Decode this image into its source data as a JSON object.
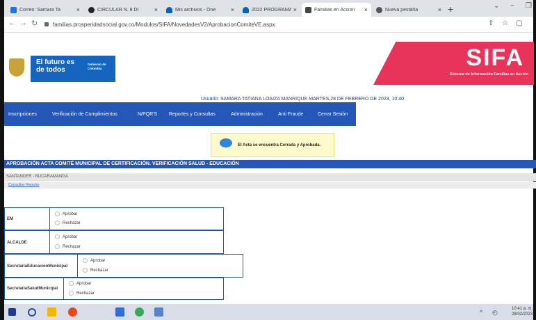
{
  "browser": {
    "tabs": [
      {
        "label": "Correo: Samara Ta",
        "active": false,
        "icon_color": "#1a73e8"
      },
      {
        "label": "CIRCULAR N. 8 DI",
        "active": false,
        "icon_color": "#222222"
      },
      {
        "label": "Mis archivos - One",
        "active": false,
        "icon_color": "#0364b8"
      },
      {
        "label": "2022 PROGRAMA",
        "active": false,
        "icon_color": "#0364b8"
      },
      {
        "label": "Familias en Acción",
        "active": true,
        "icon_color": "#444444"
      },
      {
        "label": "Nueva pestaña",
        "active": false,
        "icon_color": "#555555"
      }
    ],
    "close_glyph": "×",
    "newtab_glyph": "+",
    "minimize_glyph": "−",
    "url": "familias.prosperidadsocial.gov.co/Modulos/SIFA/NovedadesV2/AprobacionComiteVE.aspx"
  },
  "header": {
    "logo_main": "El futuro es de todos",
    "logo_sub": "Gobierno de Colombia",
    "sifa_title": "SIFA",
    "sifa_subtitle": "Sistema de Información Familias en Acción",
    "user_line": "Usuario: SAMARA TATIANA LOAIZA MANRIQUE MARTES,28 DE FEBRERO DE 2023, 10:40"
  },
  "nav": {
    "items": [
      "Inscripciones",
      "Verificación de Cumplimientos",
      "N/PQR'S",
      "Reportes y Consultas",
      "Administración",
      "Anti Fraude",
      "Cerrar Sesión"
    ]
  },
  "notice": {
    "text": "El Acta se encuentra Cerrada y Aprobada."
  },
  "section": {
    "title": "APROBACIÓN ACTA COMITÉ MUNICIPAL DE CERTIFICACIÓN. VERIFICACIÓN SALUD - EDUCACIÓN",
    "location": "SANTANDER - BUCARAMANGA",
    "consultar": "Consultar Reporte"
  },
  "approvals": [
    {
      "label": "EM",
      "approve": "Aprobar",
      "reject": "Rechazar"
    },
    {
      "label": "ALCALDE",
      "approve": "Aprobar",
      "reject": "Rechazar"
    },
    {
      "label": "SecretariaEducacionMunicipal",
      "approve": "Aprobar",
      "reject": "Rechazar"
    },
    {
      "label": "SecretariaSaludMunicipal",
      "approve": "Aprobar",
      "reject": "Rechazar"
    }
  ],
  "taskbar": {
    "time": "10:41 a. m.",
    "date": "28/02/2023",
    "tray_up": "^"
  },
  "colors": {
    "nav_blue": "#2456b8",
    "sifa_pink": "#e8335a",
    "notice_bg": "#fffbcc"
  }
}
